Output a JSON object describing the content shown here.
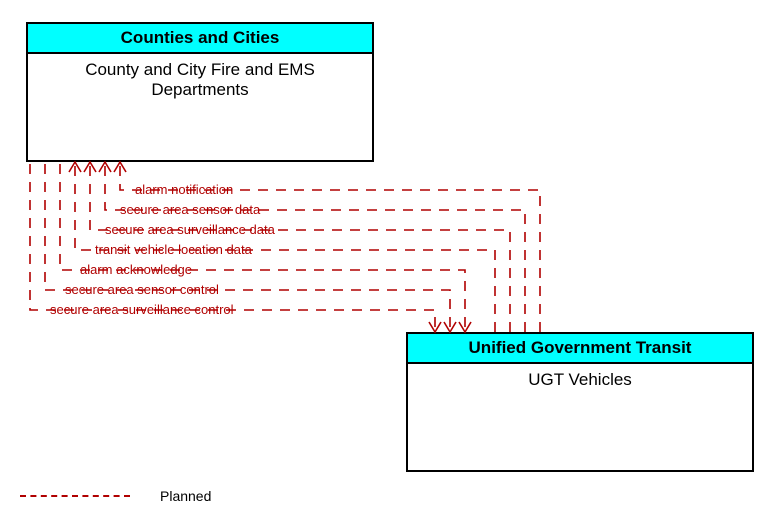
{
  "entities": {
    "top": {
      "header": "Counties and Cities",
      "body": "County and City Fire and EMS Departments"
    },
    "bottom": {
      "header": "Unified Government Transit",
      "body": "UGT Vehicles"
    }
  },
  "flows": {
    "f1": "alarm notification",
    "f2": "secure area sensor data",
    "f3": "secure area surveillance data",
    "f4": "transit vehicle location data",
    "f5": "alarm acknowledge",
    "f6": "secure area sensor control",
    "f7": "secure area surveillance control"
  },
  "legend": {
    "planned": "Planned"
  },
  "colors": {
    "planned": "#b10000",
    "header_bg": "#00ffff"
  },
  "chart_data": {
    "type": "diagram",
    "nodes": [
      {
        "id": "fire_ems",
        "group": "Counties and Cities",
        "label": "County and City Fire and EMS Departments"
      },
      {
        "id": "ugt_vehicles",
        "group": "Unified Government Transit",
        "label": "UGT Vehicles"
      }
    ],
    "edges": [
      {
        "from": "ugt_vehicles",
        "to": "fire_ems",
        "label": "alarm notification",
        "status": "planned"
      },
      {
        "from": "ugt_vehicles",
        "to": "fire_ems",
        "label": "secure area sensor data",
        "status": "planned"
      },
      {
        "from": "ugt_vehicles",
        "to": "fire_ems",
        "label": "secure area surveillance data",
        "status": "planned"
      },
      {
        "from": "ugt_vehicles",
        "to": "fire_ems",
        "label": "transit vehicle location data",
        "status": "planned"
      },
      {
        "from": "fire_ems",
        "to": "ugt_vehicles",
        "label": "alarm acknowledge",
        "status": "planned"
      },
      {
        "from": "fire_ems",
        "to": "ugt_vehicles",
        "label": "secure area sensor control",
        "status": "planned"
      },
      {
        "from": "fire_ems",
        "to": "ugt_vehicles",
        "label": "secure area surveillance control",
        "status": "planned"
      }
    ],
    "legend": [
      {
        "style": "dashed",
        "color": "#b10000",
        "label": "Planned"
      }
    ]
  }
}
